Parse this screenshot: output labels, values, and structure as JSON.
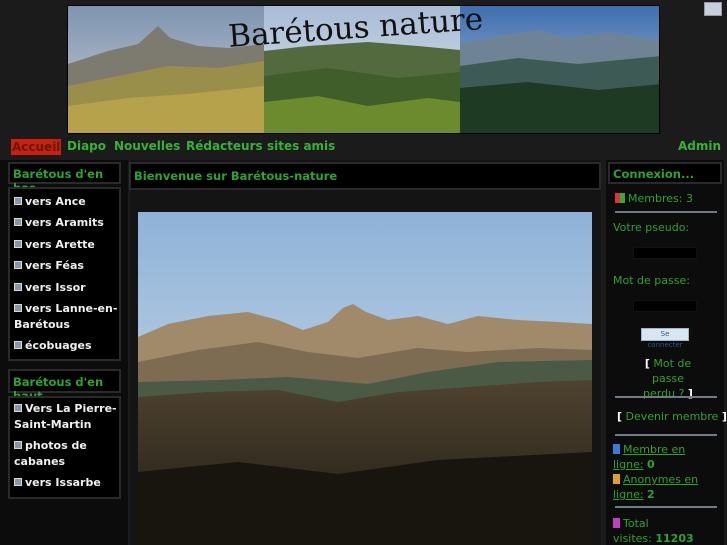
{
  "banner": {
    "title": "Barétous nature"
  },
  "nav": {
    "items": [
      "Accueil",
      "Diapo",
      "Nouvelles",
      "Rédacteurs",
      "sites amis"
    ],
    "admin": "Admin"
  },
  "left": {
    "block1": {
      "title": "Barétous d'en bas",
      "links": [
        "vers Ance",
        "vers Aramits",
        "vers Arette",
        "vers Féas",
        "vers Issor",
        "vers Lanne-en-",
        "Barétous",
        "écobuages"
      ]
    },
    "block2": {
      "title": "Barétous d'en haut",
      "links": [
        "Vers La Pierre-",
        "Saint-Martin",
        "photos de",
        "cabanes",
        "vers Issarbe"
      ]
    }
  },
  "main": {
    "title": "Bienvenue sur Barétous-nature"
  },
  "login": {
    "title": "Connexion...",
    "members_label": "Membres:",
    "members_count": "3",
    "pseudo_label": "Votre pseudo:",
    "password_label": "Mot de passe:",
    "connect_button": "Se connecter",
    "forgot_line1": "Mot de passe",
    "forgot_line2": "perdu ?",
    "become_member": "Devenir membre",
    "open_bracket": "[",
    "close_bracket": "]",
    "online_members_line1": "Membre en",
    "online_members_line2": "ligne:",
    "online_members_count": "0",
    "anon_line1": "Anonymes en",
    "anon_line2": "ligne:",
    "anon_count": "2",
    "total_line1": "Total",
    "total_line2": "visites:",
    "total_count": "11203"
  }
}
